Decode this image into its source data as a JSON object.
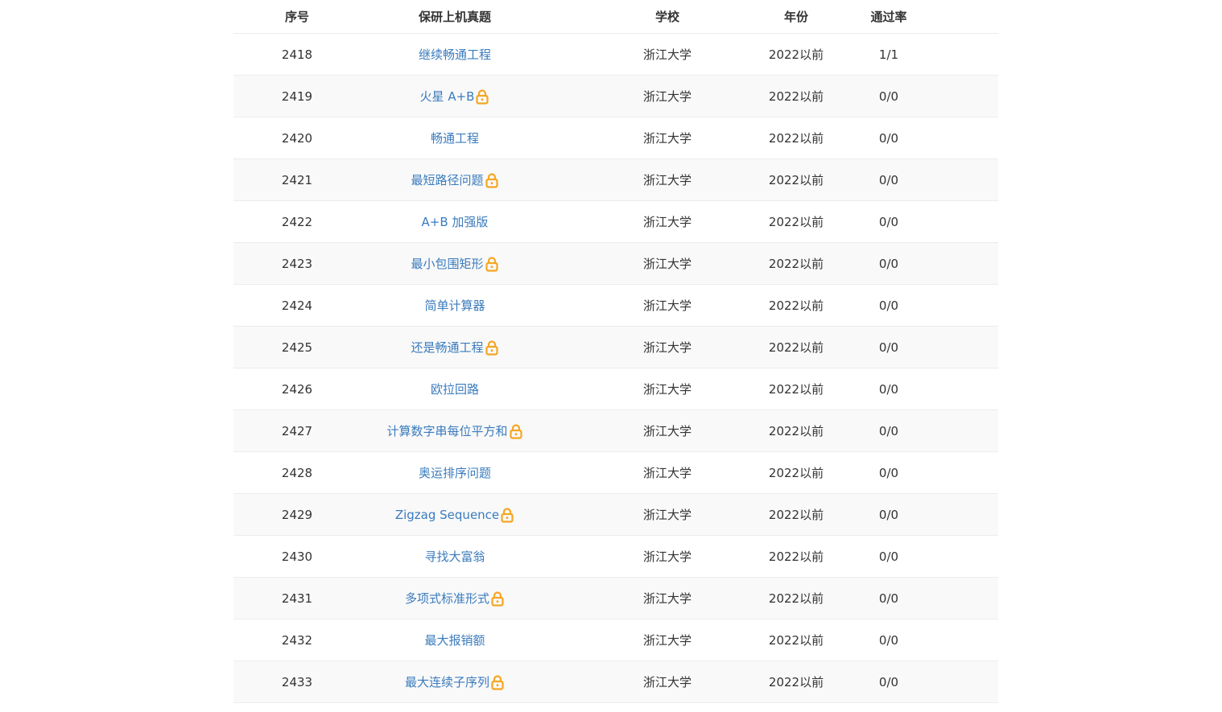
{
  "header": {
    "id": "序号",
    "title": "保研上机真题",
    "school": "学校",
    "year": "年份",
    "rate": "通过率"
  },
  "colors": {
    "link": "#3a7bbd",
    "lock": "#f5a623",
    "alt_row": "#f9f9f9",
    "divider": "#ececec"
  },
  "rows": [
    {
      "id": "2418",
      "title": "继续畅通工程",
      "locked": false,
      "school": "浙江大学",
      "year": "2022以前",
      "rate": "1/1"
    },
    {
      "id": "2419",
      "title": "火星 A+B",
      "locked": true,
      "school": "浙江大学",
      "year": "2022以前",
      "rate": "0/0"
    },
    {
      "id": "2420",
      "title": "畅通工程",
      "locked": false,
      "school": "浙江大学",
      "year": "2022以前",
      "rate": "0/0"
    },
    {
      "id": "2421",
      "title": "最短路径问题",
      "locked": true,
      "school": "浙江大学",
      "year": "2022以前",
      "rate": "0/0"
    },
    {
      "id": "2422",
      "title": "A+B 加强版",
      "locked": false,
      "school": "浙江大学",
      "year": "2022以前",
      "rate": "0/0"
    },
    {
      "id": "2423",
      "title": "最小包围矩形",
      "locked": true,
      "school": "浙江大学",
      "year": "2022以前",
      "rate": "0/0"
    },
    {
      "id": "2424",
      "title": "简单计算器",
      "locked": false,
      "school": "浙江大学",
      "year": "2022以前",
      "rate": "0/0"
    },
    {
      "id": "2425",
      "title": "还是畅通工程",
      "locked": true,
      "school": "浙江大学",
      "year": "2022以前",
      "rate": "0/0"
    },
    {
      "id": "2426",
      "title": "欧拉回路",
      "locked": false,
      "school": "浙江大学",
      "year": "2022以前",
      "rate": "0/0"
    },
    {
      "id": "2427",
      "title": "计算数字串每位平方和",
      "locked": true,
      "school": "浙江大学",
      "year": "2022以前",
      "rate": "0/0"
    },
    {
      "id": "2428",
      "title": "奥运排序问题",
      "locked": false,
      "school": "浙江大学",
      "year": "2022以前",
      "rate": "0/0"
    },
    {
      "id": "2429",
      "title": "Zigzag Sequence",
      "locked": true,
      "school": "浙江大学",
      "year": "2022以前",
      "rate": "0/0"
    },
    {
      "id": "2430",
      "title": "寻找大富翁",
      "locked": false,
      "school": "浙江大学",
      "year": "2022以前",
      "rate": "0/0"
    },
    {
      "id": "2431",
      "title": "多项式标准形式",
      "locked": true,
      "school": "浙江大学",
      "year": "2022以前",
      "rate": "0/0"
    },
    {
      "id": "2432",
      "title": "最大报销额",
      "locked": false,
      "school": "浙江大学",
      "year": "2022以前",
      "rate": "0/0"
    },
    {
      "id": "2433",
      "title": "最大连续子序列",
      "locked": true,
      "school": "浙江大学",
      "year": "2022以前",
      "rate": "0/0"
    }
  ]
}
